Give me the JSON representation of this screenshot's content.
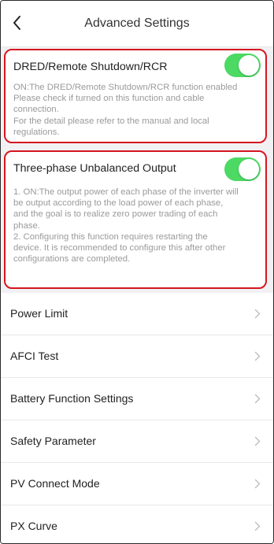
{
  "header": {
    "title": "Advanced Settings",
    "back_icon": "chevron-left-icon"
  },
  "cards": [
    {
      "title": "DRED/Remote Shutdown/RCR",
      "enabled": true,
      "description": [
        "ON:The DRED/Remote Shutdown/RCR function enabled",
        "Please check if turned on this function and cable",
        "connection.",
        "For the detail please refer to the manual and local",
        "regulations."
      ]
    },
    {
      "title": "Three-phase Unbalanced Output",
      "enabled": true,
      "description": [
        "1. ON:The output power of each phase of the inverter will",
        "be output according to the load power of each phase,",
        "and the goal is to realize zero power trading of each",
        "phase.",
        "2. Configuring this function requires restarting the",
        "device. It is recommended to configure this after other",
        "configurations are completed."
      ]
    }
  ],
  "menu": {
    "items": [
      {
        "label": "Power Limit"
      },
      {
        "label": "AFCI Test"
      },
      {
        "label": "Battery Function Settings"
      },
      {
        "label": "Safety Parameter"
      },
      {
        "label": "PV Connect Mode"
      },
      {
        "label": "PX Curve"
      }
    ],
    "chevron_icon": "chevron-right-icon"
  },
  "colors": {
    "toggle_on": "#4cd964",
    "highlight_border": "#d6161f",
    "description_text": "#9a9a9a"
  }
}
